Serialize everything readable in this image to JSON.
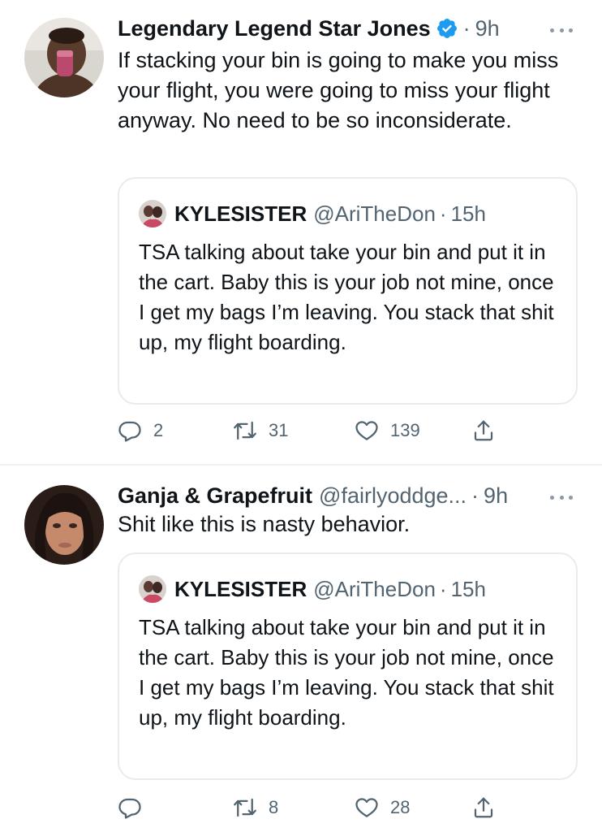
{
  "colors": {
    "text": "#0f1419",
    "secondary": "#536471",
    "verified": "#1d9bf0",
    "border": "#e6ecf0"
  },
  "tweets": [
    {
      "display_name": "Legendary Legend Star Jones",
      "verified": true,
      "handle": "",
      "separator": "·",
      "time": "9h",
      "text": "If stacking your bin is going to make you miss your flight, you were going to miss your flight anyway. No need to be so inconsiderate.",
      "quote": {
        "display_name": "KYLESISTER",
        "handle": "@AriTheDon",
        "separator": "·",
        "time": "15h",
        "text": "TSA talking about take your bin and put it in the cart. Baby this is your job not mine, once I get my bags I’m leaving. You stack that shit up, my flight boarding."
      },
      "actions": {
        "replies": "2",
        "retweets": "31",
        "likes": "139"
      },
      "icons": [
        "reply-icon",
        "retweet-icon",
        "like-icon",
        "share-icon",
        "more-icon",
        "verified-icon"
      ]
    },
    {
      "display_name": "Ganja & Grapefruit",
      "verified": false,
      "handle": "@fairlyoddge...",
      "separator": "·",
      "time": "9h",
      "text": "Shit like this is nasty behavior.",
      "quote": {
        "display_name": "KYLESISTER",
        "handle": "@AriTheDon",
        "separator": "·",
        "time": "15h",
        "text": "TSA talking about take your bin and put it in the cart. Baby this is your job not mine, once I get my bags I’m leaving. You stack that shit up, my flight boarding."
      },
      "actions": {
        "replies": "",
        "retweets": "8",
        "likes": "28"
      },
      "icons": [
        "reply-icon",
        "retweet-icon",
        "like-icon",
        "share-icon",
        "more-icon"
      ]
    }
  ]
}
